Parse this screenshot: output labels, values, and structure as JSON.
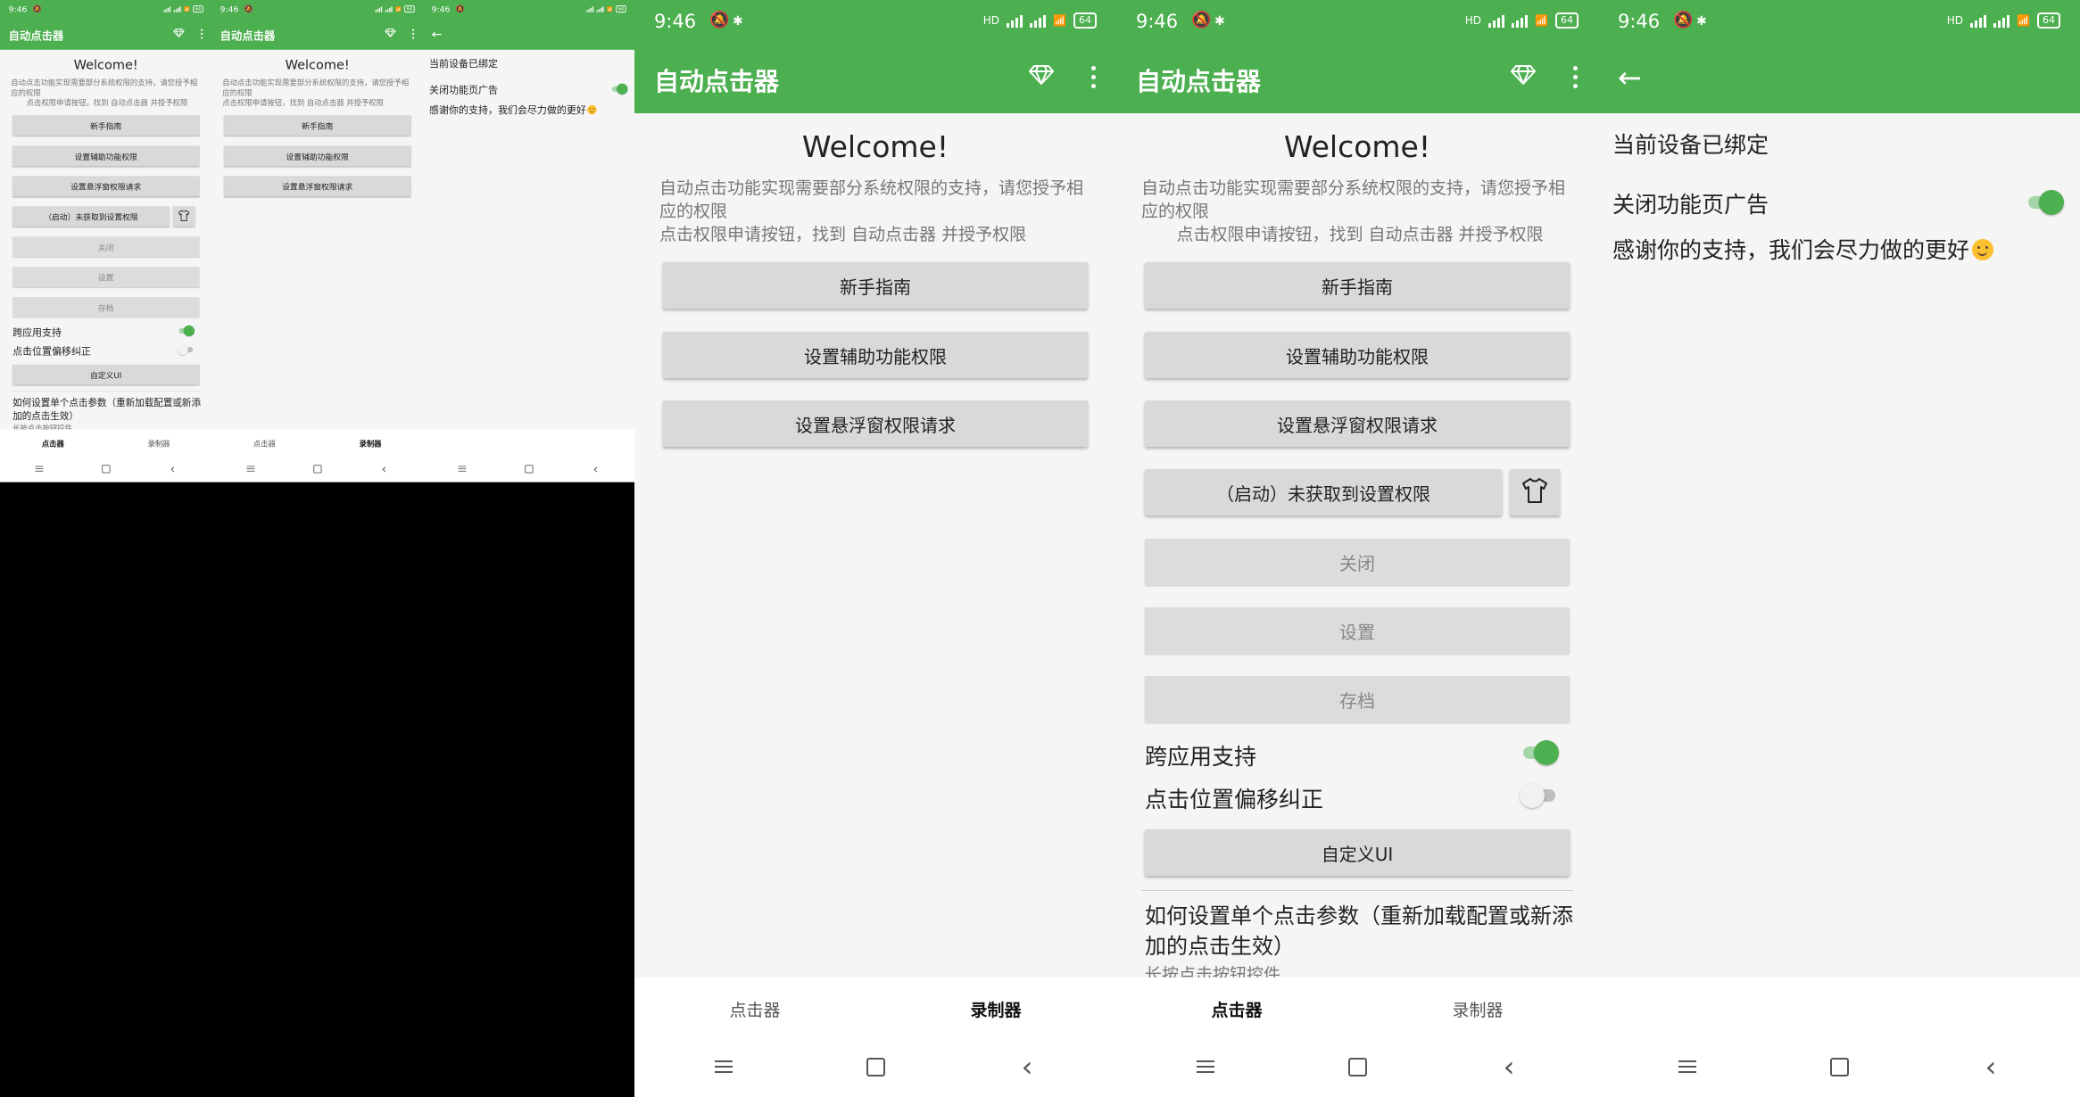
{
  "status": {
    "time": "9:46",
    "battery": "64",
    "net": "HD"
  },
  "app": {
    "title": "自动点击器"
  },
  "main": {
    "welcome": "Welcome!",
    "desc1": "自动点击功能实现需要部分系统权限的支持，请您授予相应的权限",
    "desc2": "点击权限申请按钮，找到 自动点击器 并授予权限",
    "btn_guide": "新手指南",
    "btn_accessibility": "设置辅助功能权限",
    "btn_overlay": "设置悬浮窗权限请求",
    "btn_start": "（启动）未获取到设置权限",
    "btn_close": "关闭",
    "btn_settings": "设置",
    "btn_archive": "存档",
    "cross_app": "跨应用支持",
    "offset_fix": "点击位置偏移纠正",
    "btn_custom_ui": "自定义UI",
    "howto": "如何设置单个点击参数（重新加载配置或新添加的点击生效）",
    "hint": "长按点击按钮控件"
  },
  "tabs": {
    "clicker": "点击器",
    "recorder": "录制器"
  },
  "settings": {
    "bound": "当前设备已绑定",
    "close_ads": "关闭功能页广告",
    "thanks": "感谢你的支持，我们会尽力做的更好"
  },
  "toggles": {
    "cross_app_on": true,
    "offset_fix_on": false,
    "close_ads_on": true
  },
  "colors": {
    "accent": "#4caf50",
    "background": "#f5f5f5",
    "button": "#d9d9d9"
  },
  "icons": [
    "bell-off-icon",
    "signal-icon",
    "wifi-icon",
    "battery-icon",
    "gem-icon",
    "more-icon",
    "shirt-icon",
    "back-arrow-icon",
    "menu-icon",
    "home-icon",
    "back-icon"
  ]
}
